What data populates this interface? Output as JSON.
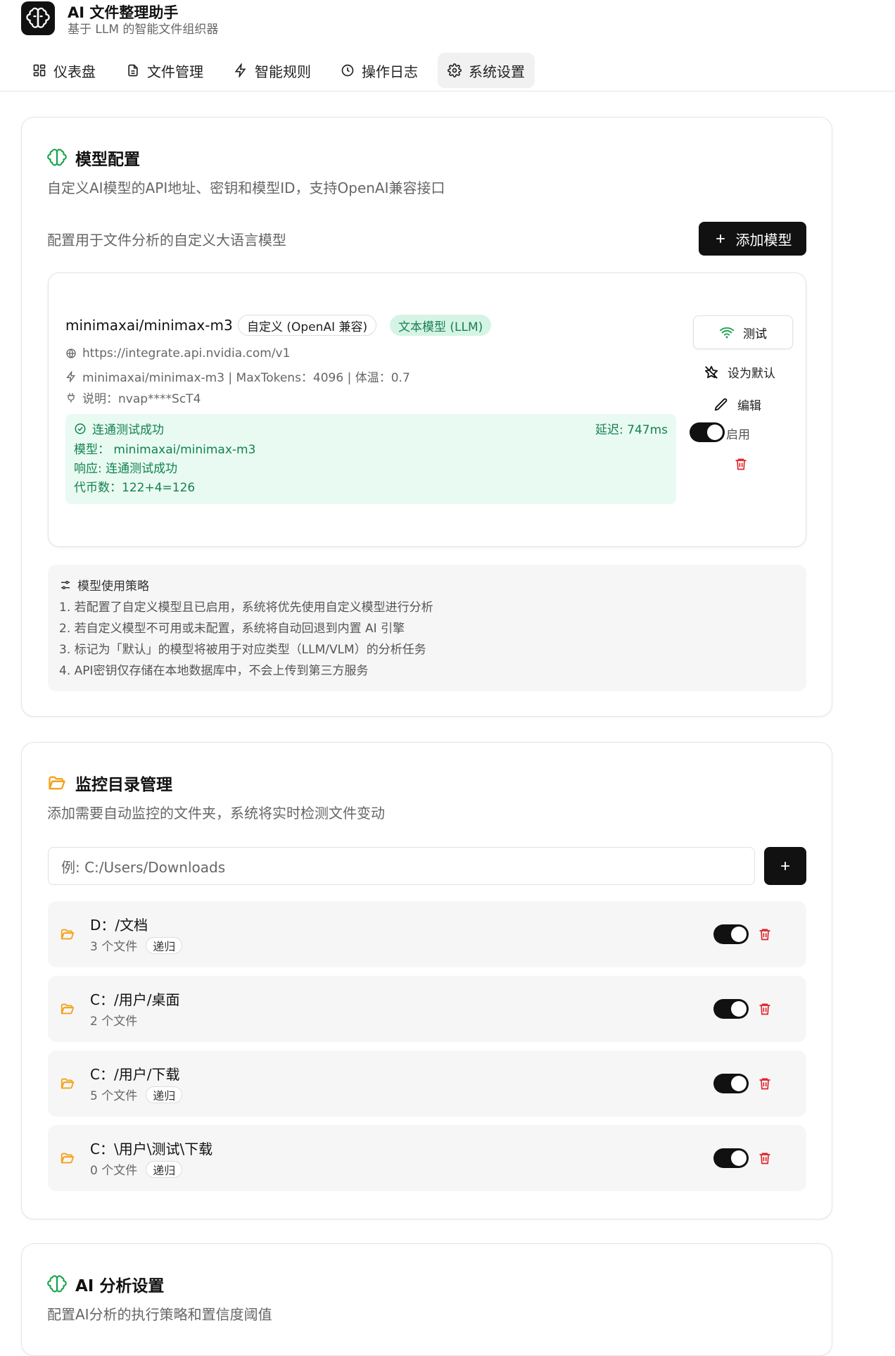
{
  "app": {
    "title": "AI 文件整理助手",
    "subtitle": "基于 LLM 的智能文件组织器"
  },
  "nav": {
    "tabs": [
      {
        "label": "仪表盘",
        "icon": "dashboard-icon"
      },
      {
        "label": "文件管理",
        "icon": "file-icon"
      },
      {
        "label": "智能规则",
        "icon": "lightning-icon"
      },
      {
        "label": "操作日志",
        "icon": "clock-icon"
      },
      {
        "label": "系统设置",
        "icon": "gear-icon",
        "active": true
      }
    ]
  },
  "model_config": {
    "title": "模型配置",
    "description": "自定义AI模型的API地址、密钥和模型ID，支持OpenAI兼容接口",
    "subheading": "配置用于文件分析的自定义大语言模型",
    "add_button": "添加模型",
    "model": {
      "name": "minimaxai/minimax-m3",
      "provider_badge": "自定义 (OpenAI 兼容)",
      "type_badge": "文本模型 (LLM)",
      "url": "https://integrate.api.nvidia.com/v1",
      "details": "minimaxai/minimax-m3 | MaxTokens：4096 | 体温：0.7",
      "note": "说明：nvap****ScT4",
      "test_status": "连通测试成功",
      "latency": "延迟: 747ms",
      "result_model": "模型：  minimaxai/minimax-m3",
      "result_response": "响应: 连通测试成功",
      "result_tokens": "代币数：122+4=126",
      "test_button": "测试",
      "default_button": "设为默认",
      "edit_button": "编辑",
      "enable_label": "启用",
      "enabled": true
    },
    "policy": {
      "title": "模型使用策略",
      "lines": [
        "1. 若配置了自定义模型且已启用，系统将优先使用自定义模型进行分析",
        "2. 若自定义模型不可用或未配置，系统将自动回退到内置 AI 引擎",
        "3. 标记为「默认」的模型将被用于对应类型（LLM/VLM）的分析任务",
        "4. API密钥仅存储在本地数据库中，不会上传到第三方服务"
      ]
    }
  },
  "monitor": {
    "title": "监控目录管理",
    "description": "添加需要自动监控的文件夹，系统将实时检测文件变动",
    "input_placeholder": "例: C:/Users/Downloads",
    "add_symbol": "+",
    "directories": [
      {
        "path": "D：/文档",
        "count": "3 个文件",
        "tag": "递归",
        "enabled": true
      },
      {
        "path": "C：/用户/桌面",
        "count": "2 个文件",
        "tag": "",
        "enabled": true
      },
      {
        "path": "C：/用户/下载",
        "count": "5 个文件",
        "tag": "递归",
        "enabled": true
      },
      {
        "path": "C：\\用户\\测试\\下载",
        "count": "0 个文件",
        "tag": "递归",
        "enabled": true
      }
    ]
  },
  "ai_settings": {
    "title": "AI 分析设置",
    "description": "配置AI分析的执行策略和置信度阈值"
  },
  "colors": {
    "accent_dark": "#111111",
    "success_green": "#13824f",
    "folder_orange": "#f4a21b",
    "delete_red": "#e0242b"
  }
}
